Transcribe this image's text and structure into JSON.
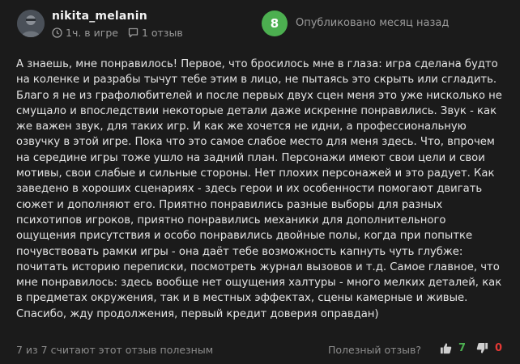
{
  "review": {
    "username": "nikita_melanin",
    "playtime": "1ч. в игре",
    "reviews_count": "1 отзыв",
    "score": "8",
    "published": "Опубликовано месяц назад",
    "text": "А знаешь, мне понравилось! Первое, что бросилось мне в глаза: игра сделана будто на коленке и разрабы тычут тебе этим в лицо, не пытаясь это скрыть или сгладить. Благо я не из графолюбителей и после первых двух сцен меня это уже нисколько не смущало и впоследствии некоторые детали даже искренне понравились. Звук - как же важен звук, для таких игр. И как же хочется не идни, а профессиональную озвучку в этой игре. Пока что это самое слабое место для меня здесь. Что, впрочем на середине игры тоже ушло на задний план. Персонажи имеют свои цели и свои мотивы, свои слабые и сильные стороны. Нет плохих персонажей и это радует. Как заведено в хороших сценариях - здесь герои и их особенности помогают двигать сюжет и дополняют его. Приятно понравились разные выборы для разных психотипов игроков, приятно понравились механики для дополнительного ощущения присутствия и особо понравились двойные полы, когда при попытке почувствовать рамки игры - она даёт тебе возможность капнуть чуть глубже: почитать историю переписки, посмотреть журнал вызовов и т.д. Самое главное, что мне понравилось: здесь вообще нет ощущения халтуры - много мелких деталей, как в предметах окружения, так и в местных эффектах, сцены камерные и живые. Спасибо, жду продолжения, первый кредит доверия оправдан)"
  },
  "footer": {
    "helpful_count": "7 из 7 считают этот отзыв полезным",
    "helpful_question": "Полезный отзыв?",
    "upvotes": "7",
    "downvotes": "0"
  },
  "colors": {
    "background": "#1b1b1b",
    "score_badge": "#4caf50",
    "upvote": "#4caf50",
    "downvote": "#e53935"
  },
  "icons": {
    "playtime": "clock-icon",
    "reviews": "comment-icon",
    "upvote": "thumbs-up-icon",
    "downvote": "thumbs-down-icon"
  }
}
